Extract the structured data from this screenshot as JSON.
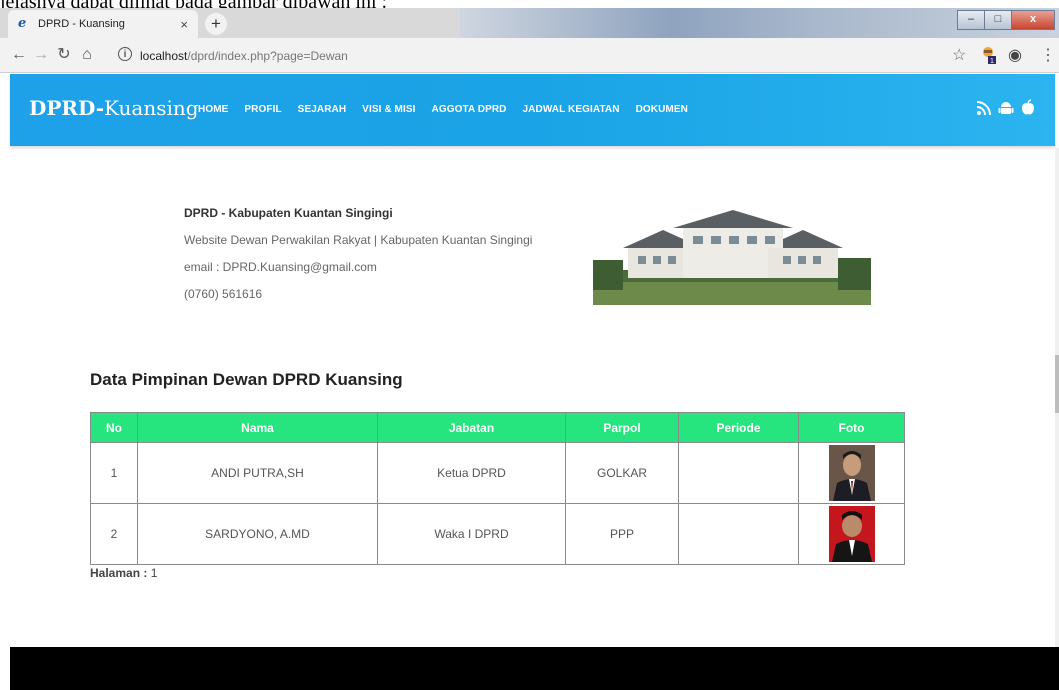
{
  "document": {
    "top_text": "jelasnya dapat dilihat pada gambar dibawah ini :"
  },
  "browser": {
    "tab_title": "DPRD - Kuansing",
    "tab_close": "×",
    "new_tab": "+",
    "url_host": "localhost",
    "url_path": "/dprd/index.php?page=Dewan",
    "window_buttons": {
      "minimize": "–",
      "maximize": "□",
      "close": "x"
    }
  },
  "site": {
    "logo_bold": "DPRD",
    "logo_sep": "-",
    "logo_light": "Kuansing",
    "menu": [
      "HOME",
      "PROFIL",
      "SEJARAH",
      "VISI & MISI",
      "AGGOTA DPRD",
      "JADWAL KEGIATAN",
      "DOKUMEN"
    ],
    "social_icons": [
      "rss-icon",
      "android-icon",
      "apple-icon"
    ]
  },
  "info": {
    "name": "DPRD - Kabupaten Kuantan Singingi",
    "line1": "Website Dewan Perwakilan Rakyat | Kabupaten Kuantan Singingi",
    "line2": "email : DPRD.Kuansing@gmail.com",
    "line3": "(0760) 561616"
  },
  "section": {
    "title": "Data Pimpinan Dewan DPRD Kuansing"
  },
  "table": {
    "headers": [
      "No",
      "Nama",
      "Jabatan",
      "Parpol",
      "Periode",
      "Foto"
    ],
    "rows": [
      {
        "no": "1",
        "nama": "ANDI PUTRA,SH",
        "jabatan": "Ketua DPRD",
        "parpol": "GOLKAR",
        "periode": ""
      },
      {
        "no": "2",
        "nama": "SARDYONO, A.MD",
        "jabatan": "Waka I DPRD",
        "parpol": "PPP",
        "periode": ""
      }
    ]
  },
  "pagination": {
    "label": "Halaman :",
    "value": " 1"
  },
  "colors": {
    "header_blue": "#1ea1e8",
    "table_header_green": "#26e57e",
    "footer": "#000000"
  }
}
